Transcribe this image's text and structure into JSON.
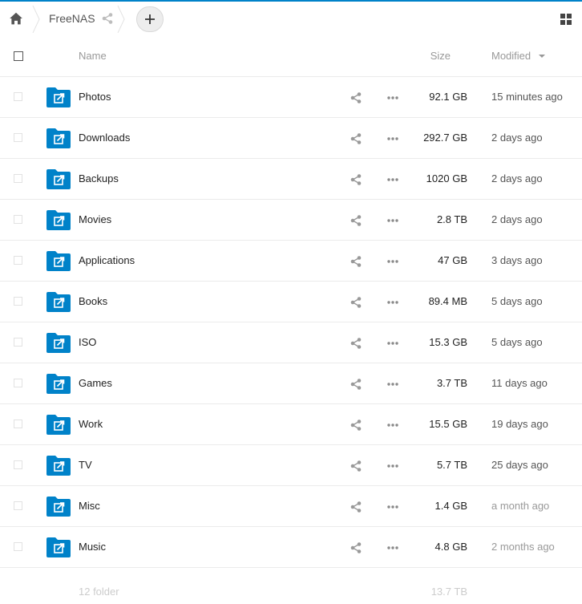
{
  "breadcrumb": {
    "current": "FreeNAS"
  },
  "table": {
    "headers": {
      "name": "Name",
      "size": "Size",
      "modified": "Modified"
    },
    "rows": [
      {
        "name": "Photos",
        "size": "92.1 GB",
        "modified": "15 minutes ago"
      },
      {
        "name": "Downloads",
        "size": "292.7 GB",
        "modified": "2 days ago"
      },
      {
        "name": "Backups",
        "size": "1020 GB",
        "modified": "2 days ago"
      },
      {
        "name": "Movies",
        "size": "2.8 TB",
        "modified": "2 days ago"
      },
      {
        "name": "Applications",
        "size": "47 GB",
        "modified": "3 days ago"
      },
      {
        "name": "Books",
        "size": "89.4 MB",
        "modified": "5 days ago"
      },
      {
        "name": "ISO",
        "size": "15.3 GB",
        "modified": "5 days ago"
      },
      {
        "name": "Games",
        "size": "3.7 TB",
        "modified": "11 days ago"
      },
      {
        "name": "Work",
        "size": "15.5 GB",
        "modified": "19 days ago"
      },
      {
        "name": "TV",
        "size": "5.7 TB",
        "modified": "25 days ago"
      },
      {
        "name": "Misc",
        "size": "1.4 GB",
        "modified": "a month ago"
      },
      {
        "name": "Music",
        "size": "4.8 GB",
        "modified": "2 months ago"
      }
    ]
  },
  "footer": {
    "count": "12 folder",
    "total_size": "13.7 TB"
  },
  "icons": {
    "home": "home-icon",
    "share": "share-icon",
    "more": "more-icon",
    "add": "plus-icon",
    "view": "grid-view-icon",
    "folder": "external-folder-icon"
  },
  "colors": {
    "accent": "#0082c9"
  }
}
